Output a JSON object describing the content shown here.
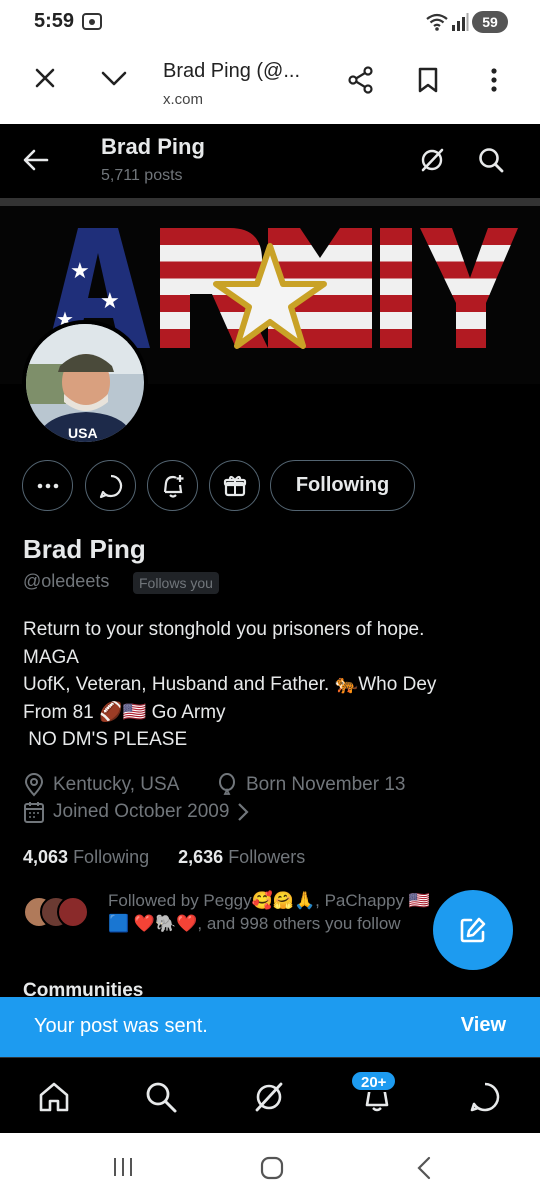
{
  "status_bar": {
    "time": "5:59",
    "battery": "59"
  },
  "browser": {
    "page_title": "Brad Ping (@...",
    "url": "x.com"
  },
  "header": {
    "name": "Brad Ping",
    "posts": "5,711 posts"
  },
  "profile": {
    "display_name": "Brad Ping",
    "handle": "@oledeets",
    "follows_you": "Follows you",
    "following_button": "Following",
    "bio_lines": [
      "Return to your stonghold you prisoners of hope.",
      "MAGA",
      "UofK, Veteran, Husband and Father. 🐅Who Dey",
      "From 81 🏈🇺🇸 Go Army",
      " NO DM'S PLEASE"
    ],
    "location": "Kentucky, USA",
    "born": "Born November 13",
    "joined": "Joined October 2009",
    "following_count": "4,063",
    "following_label": "Following",
    "followers_count": "2,636",
    "followers_label": "Followers",
    "followed_by": "Followed by Peggy🥰🤗🙏, PaChappy 🇺🇸🟦 ❤️🐘❤️, and 998 others you follow"
  },
  "section": {
    "communities": "Communities"
  },
  "toast": {
    "message": "Your post was sent.",
    "action": "View"
  },
  "bottom_nav": {
    "notifications_badge": "20+"
  },
  "colors": {
    "accent": "#1d9bf0",
    "background": "#000000",
    "text": "#e7e9ea",
    "muted": "#71767b"
  },
  "icons": [
    "close-icon",
    "chevron-down-icon",
    "share-icon",
    "bookmark-icon",
    "more-vertical-icon",
    "back-arrow-icon",
    "grok-icon",
    "search-icon",
    "more-horizontal-icon",
    "message-icon",
    "notify-add-icon",
    "gift-icon",
    "location-icon",
    "birthday-icon",
    "calendar-icon",
    "compose-icon",
    "home-icon",
    "bell-icon"
  ]
}
